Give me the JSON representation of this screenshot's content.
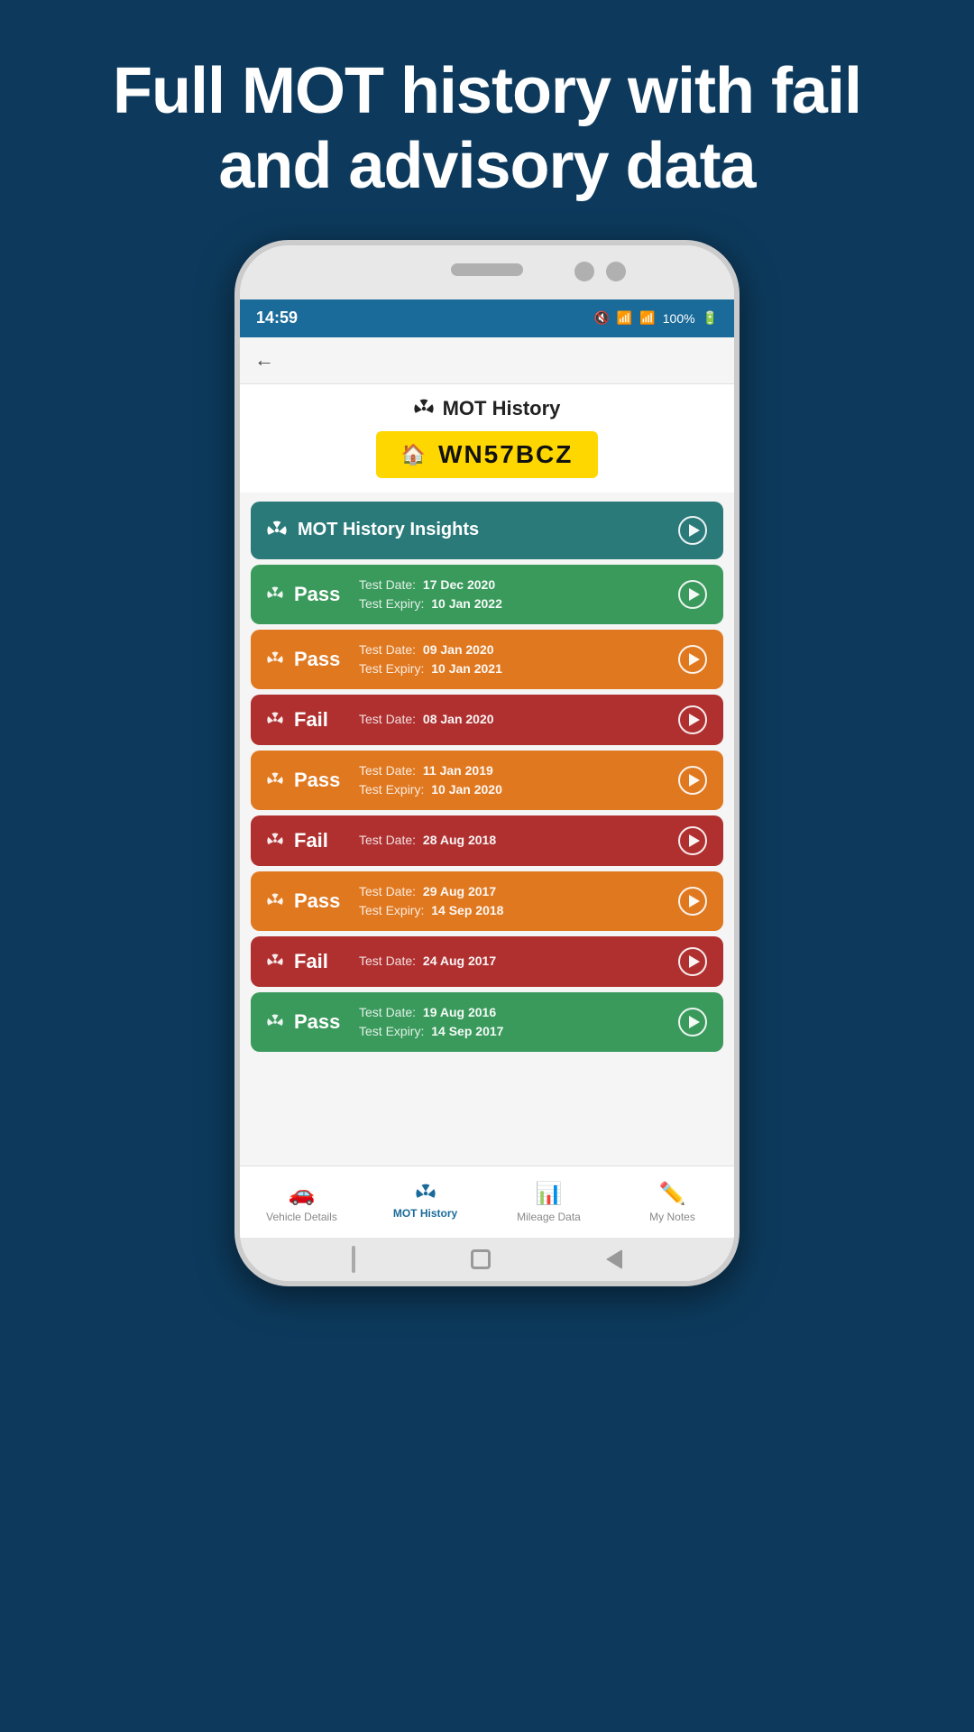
{
  "hero": {
    "title": "Full MOT history with fail and advisory data"
  },
  "status_bar": {
    "time": "14:59",
    "battery": "100%"
  },
  "header": {
    "title": "MOT History",
    "plate": "WN57BCZ"
  },
  "insights": {
    "label": "MOT History Insights"
  },
  "mot_records": [
    {
      "status": "Pass",
      "color": "pass-green",
      "test_date_label": "Test Date:",
      "test_date": "17 Dec 2020",
      "expiry_label": "Test Expiry:",
      "expiry": "10 Jan 2022"
    },
    {
      "status": "Pass",
      "color": "pass-orange",
      "test_date_label": "Test Date:",
      "test_date": "09 Jan 2020",
      "expiry_label": "Test Expiry:",
      "expiry": "10 Jan 2021"
    },
    {
      "status": "Fail",
      "color": "fail-red",
      "test_date_label": "Test Date:",
      "test_date": "08 Jan 2020",
      "expiry_label": null,
      "expiry": null
    },
    {
      "status": "Pass",
      "color": "pass-orange",
      "test_date_label": "Test Date:",
      "test_date": "11 Jan 2019",
      "expiry_label": "Test Expiry:",
      "expiry": "10 Jan 2020"
    },
    {
      "status": "Fail",
      "color": "fail-red",
      "test_date_label": "Test Date:",
      "test_date": "28 Aug 2018",
      "expiry_label": null,
      "expiry": null
    },
    {
      "status": "Pass",
      "color": "pass-orange",
      "test_date_label": "Test Date:",
      "test_date": "29 Aug 2017",
      "expiry_label": "Test Expiry:",
      "expiry": "14 Sep 2018"
    },
    {
      "status": "Fail",
      "color": "fail-red",
      "test_date_label": "Test Date:",
      "test_date": "24 Aug 2017",
      "expiry_label": null,
      "expiry": null
    },
    {
      "status": "Pass",
      "color": "pass-green",
      "test_date_label": "Test Date:",
      "test_date": "19 Aug 2016",
      "expiry_label": "Test Expiry:",
      "expiry": "14 Sep 2017"
    }
  ],
  "bottom_nav": [
    {
      "label": "Vehicle Details",
      "icon": "🚗",
      "active": false
    },
    {
      "label": "MOT History",
      "icon": "☢",
      "active": true
    },
    {
      "label": "Mileage Data",
      "icon": "📊",
      "active": false
    },
    {
      "label": "My Notes",
      "icon": "✏️",
      "active": false
    }
  ]
}
